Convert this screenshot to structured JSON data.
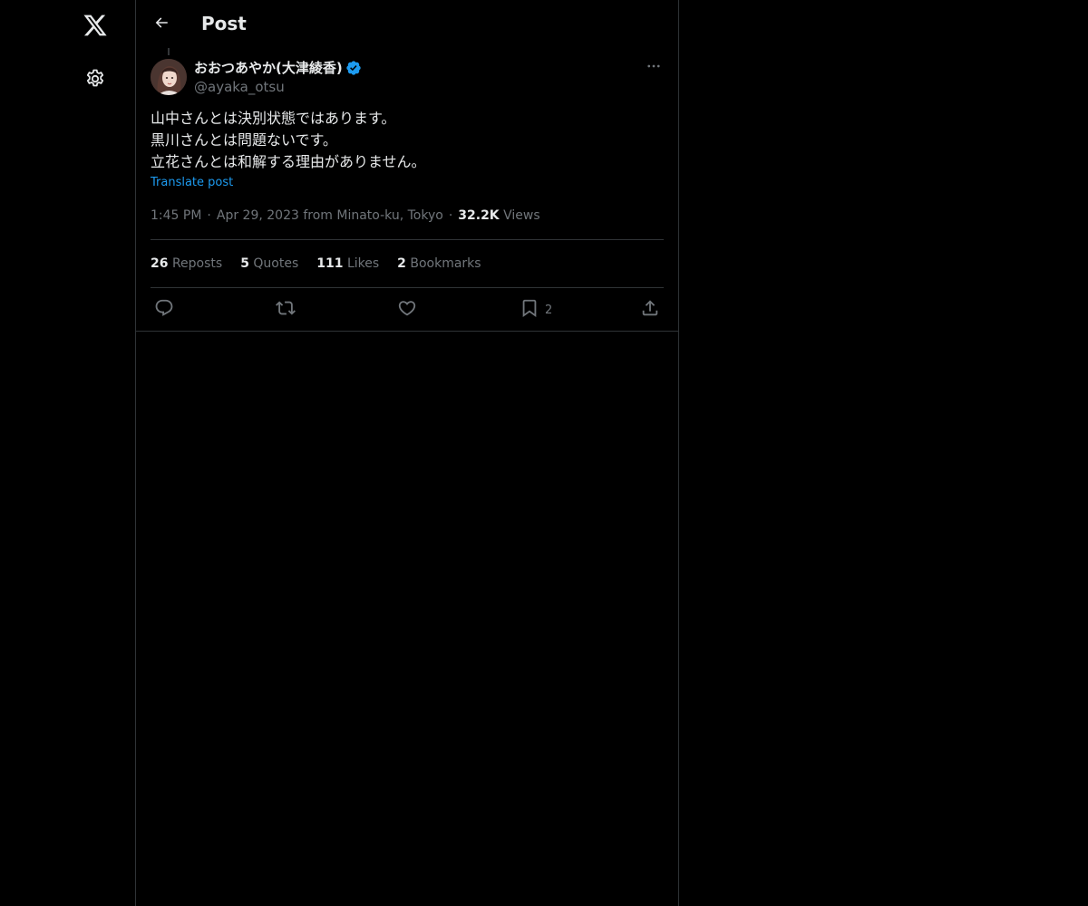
{
  "header": {
    "title": "Post"
  },
  "post": {
    "author": {
      "display_name": "おおつあやか(大津綾香)",
      "handle": "@ayaka_otsu",
      "verified": true
    },
    "text_lines": [
      "山中さんとは決別状態ではあります。",
      "黒川さんとは問題ないです。",
      "立花さんとは和解する理由がありません。"
    ],
    "translate_label": "Translate post",
    "time": "1:45 PM",
    "date_location": "Apr 29, 2023 from Minato-ku, Tokyo",
    "separator": "·",
    "views_count": "32.2K",
    "views_label": "Views",
    "stats": {
      "reposts": {
        "count": "26",
        "label": "Reposts"
      },
      "quotes": {
        "count": "5",
        "label": "Quotes"
      },
      "likes": {
        "count": "111",
        "label": "Likes"
      },
      "bookmarks": {
        "count": "2",
        "label": "Bookmarks"
      }
    },
    "actions": {
      "bookmark_count": "2"
    }
  },
  "icons": {
    "logo": "x-logo-icon",
    "settings": "gear-icon",
    "back": "arrow-left-icon",
    "verified": "verified-badge-icon",
    "more": "more-horizontal-icon",
    "reply": "reply-icon",
    "repost": "repost-icon",
    "like": "heart-icon",
    "bookmark": "bookmark-icon",
    "share": "share-icon"
  },
  "colors": {
    "background": "#000000",
    "text_primary": "#e7e9ea",
    "text_secondary": "#71767b",
    "accent": "#1d9bf0",
    "border": "#2f3336"
  }
}
